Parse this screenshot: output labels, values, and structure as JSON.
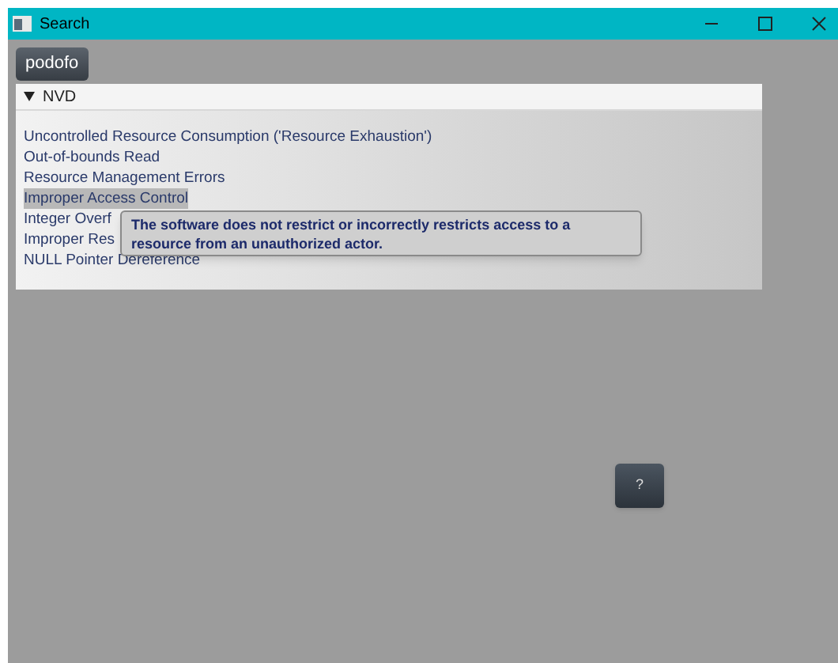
{
  "window": {
    "title": "Search"
  },
  "tabs": [
    {
      "label": "podofo",
      "selected": true
    }
  ],
  "section": {
    "title": "NVD",
    "expanded": true,
    "items": [
      {
        "label": "Uncontrolled Resource Consumption ('Resource Exhaustion')",
        "selected": false
      },
      {
        "label": "Out-of-bounds Read",
        "selected": false
      },
      {
        "label": "Resource Management Errors",
        "selected": false
      },
      {
        "label": "Improper Access Control",
        "selected": true
      },
      {
        "label": "Integer Overf",
        "selected": false
      },
      {
        "label": "Improper Res",
        "selected": false
      },
      {
        "label": "NULL Pointer Dereference",
        "selected": false
      }
    ]
  },
  "tooltip": {
    "text": "The software does not restrict or incorrectly restricts access to a resource from an unauthorized actor."
  },
  "help_button": {
    "label": "?"
  }
}
